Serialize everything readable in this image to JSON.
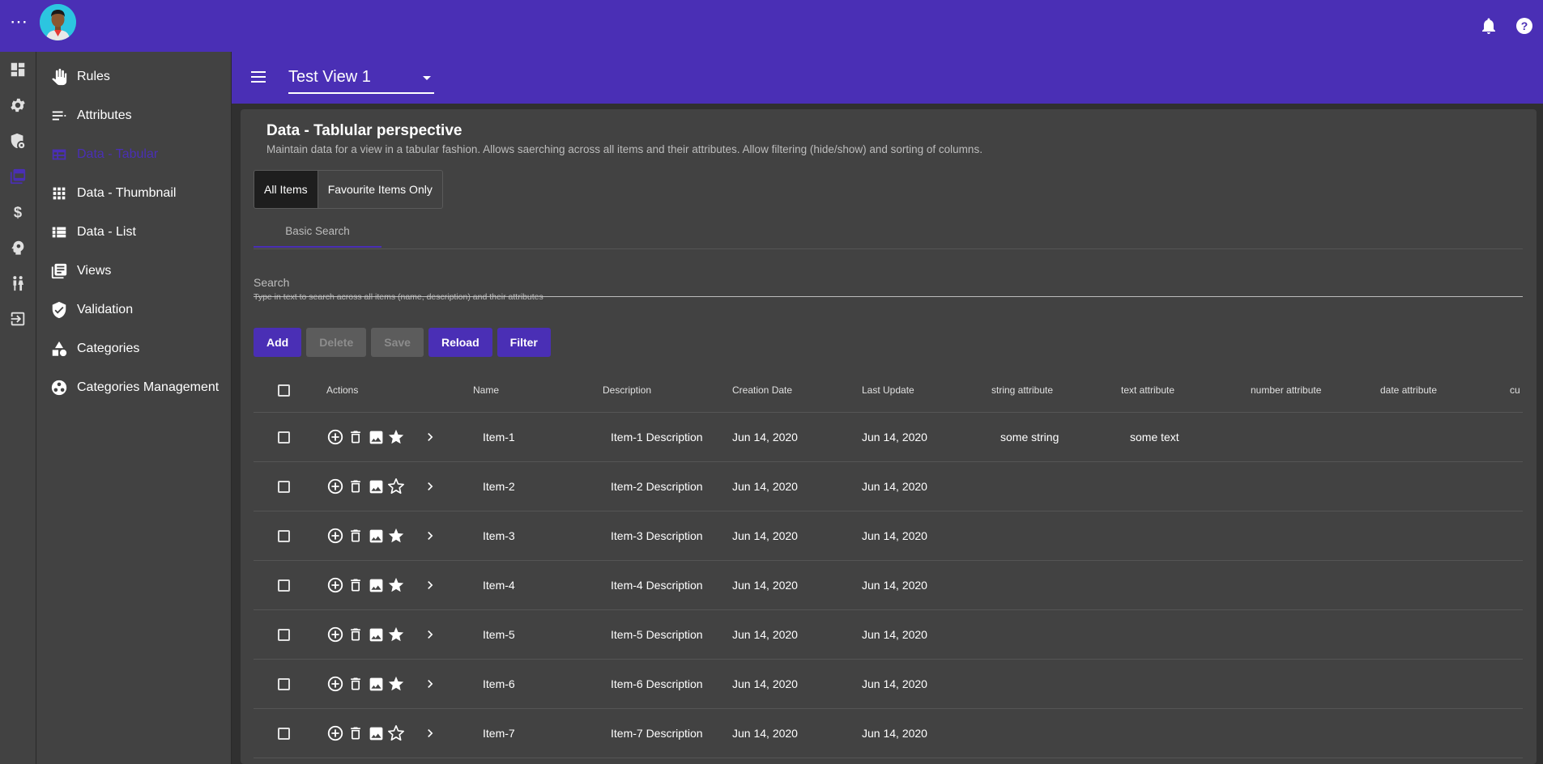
{
  "topbar": {
    "menu_label": "⋯",
    "icons": [
      "more-horiz-icon",
      "avatar",
      "bell-icon",
      "help-icon"
    ]
  },
  "rail": {
    "icons": [
      "dashboard-icon",
      "gear-icon",
      "shield-badge-icon",
      "folder-icon",
      "dollar-icon",
      "head-gear-icon",
      "people-icon",
      "exit-icon"
    ]
  },
  "nav": {
    "items": [
      {
        "label": "Rules",
        "icon": "hand-icon"
      },
      {
        "label": "Attributes",
        "icon": "list-icon"
      },
      {
        "label": "Data - Tabular",
        "icon": "table-icon",
        "active": true
      },
      {
        "label": "Data - Thumbnail",
        "icon": "grid-icon"
      },
      {
        "label": "Data - List",
        "icon": "view-list-icon"
      },
      {
        "label": "Views",
        "icon": "library-icon"
      },
      {
        "label": "Validation",
        "icon": "verified-shield-icon"
      },
      {
        "label": "Categories",
        "icon": "shapes-icon"
      },
      {
        "label": "Categories Management",
        "icon": "workspaces-icon"
      }
    ]
  },
  "subbar": {
    "view_selected": "Test View 1"
  },
  "main": {
    "title": "Data - Tablular perspective",
    "subtitle": "Maintain data for a view in a tabular fashion. Allows saerching across all items and their attributes. Allow filtering (hide/show) and sorting of columns.",
    "toggles": [
      "All Items",
      "Favourite Items Only"
    ],
    "tab": "Basic Search",
    "search": {
      "placeholder": "Search",
      "help": "Type in text to search across all items (name, description) and their attributes"
    },
    "buttons": {
      "add": "Add",
      "delete": "Delete",
      "save": "Save",
      "reload": "Reload",
      "filter": "Filter"
    }
  },
  "table": {
    "headers": {
      "actions": "Actions",
      "name": "Name",
      "description": "Description",
      "creation_date": "Creation Date",
      "last_update": "Last Update",
      "string_attr": "string attribute",
      "text_attr": "text attribute",
      "number_attr": "number attribute",
      "date_attr": "date attribute",
      "cut": "cu"
    },
    "rows": [
      {
        "name": "Item-1",
        "description": "Item-1 Description",
        "creation": "Jun 14, 2020",
        "update": "Jun 14, 2020",
        "string_attr": "some string",
        "text_attr": "some text",
        "favourite": true
      },
      {
        "name": "Item-2",
        "description": "Item-2 Description",
        "creation": "Jun 14, 2020",
        "update": "Jun 14, 2020",
        "string_attr": "",
        "text_attr": "",
        "favourite": false
      },
      {
        "name": "Item-3",
        "description": "Item-3 Description",
        "creation": "Jun 14, 2020",
        "update": "Jun 14, 2020",
        "string_attr": "",
        "text_attr": "",
        "favourite": true
      },
      {
        "name": "Item-4",
        "description": "Item-4 Description",
        "creation": "Jun 14, 2020",
        "update": "Jun 14, 2020",
        "string_attr": "",
        "text_attr": "",
        "favourite": true
      },
      {
        "name": "Item-5",
        "description": "Item-5 Description",
        "creation": "Jun 14, 2020",
        "update": "Jun 14, 2020",
        "string_attr": "",
        "text_attr": "",
        "favourite": true
      },
      {
        "name": "Item-6",
        "description": "Item-6 Description",
        "creation": "Jun 14, 2020",
        "update": "Jun 14, 2020",
        "string_attr": "",
        "text_attr": "",
        "favourite": true
      },
      {
        "name": "Item-7",
        "description": "Item-7 Description",
        "creation": "Jun 14, 2020",
        "update": "Jun 14, 2020",
        "string_attr": "",
        "text_attr": "",
        "favourite": false
      }
    ]
  },
  "colors": {
    "brand": "#4a2fb5",
    "background": "#303030",
    "surface": "#424242"
  }
}
